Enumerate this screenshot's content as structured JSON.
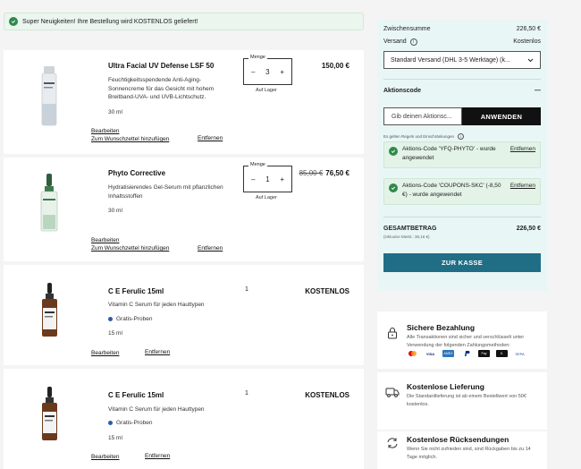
{
  "banner": {
    "text": "Super Neuigkeiten! Ihre Bestellung wird KOSTENLOS geliefert!"
  },
  "labels": {
    "quantity": "Menge",
    "in_stock": "Auf Lager",
    "edit": "Bearbeiten",
    "wishlist": "Zum Wunschzettel hinzufügen",
    "remove": "Entfernen",
    "minus": "–",
    "plus": "+"
  },
  "products": [
    {
      "name": "Ultra Facial UV Defense LSF 50",
      "description": "Feuchtigkeitsspendende Anti-Aging-Sonnencreme für das Gesicht mit hohem Breitband-UVA- und UVB-Lichtschutz.",
      "size": "30 ml",
      "quantity": "3",
      "price": "150,00 €"
    },
    {
      "name": "Phyto Corrective",
      "description": "Hydratisierendes Gel-Serum mit pflanzlichen Inhaltsstoffen",
      "size": "30 ml",
      "quantity": "1",
      "old_price": "85,00 €",
      "price": "76,50 €"
    },
    {
      "name": "C E Ferulic 15ml",
      "description": "Vitamin C Serum für jeden Hauttypen",
      "badge": "Gratis-Proben",
      "size": "15 ml",
      "quantity": "1",
      "price": "KOSTENLOS"
    },
    {
      "name": "C E Ferulic 15ml",
      "description": "Vitamin C Serum für jeden Hauttypen",
      "badge": "Gratis-Proben",
      "size": "15 ml",
      "quantity": "1",
      "price": "KOSTENLOS"
    }
  ],
  "summary": {
    "subtotal_label": "Zwischensumme",
    "subtotal_value": "226,50 €",
    "shipping_label": "Versand",
    "shipping_value": "Kostenlos",
    "shipping_select": "Standard Versand (DHL 3-5 Werktage) (k...",
    "coupon_label": "Aktionscode",
    "coupon_toggle": "—",
    "coupon_placeholder": "Gib deinen Aktionsc...",
    "apply_label": "ANWENDEN",
    "terms": "Es gelten Regeln und Einschränkungen",
    "applied": [
      {
        "text": "Aktions-Code 'YFQ-PHYTO' - wurde angewendet",
        "remove": "Entfernen"
      },
      {
        "text": "Aktions-Code 'COUPONS-SKC' (-8,50 €) - wurde angewendet",
        "remove": "Entfernen"
      }
    ],
    "total_label": "GESAMTBETRAG",
    "total_value": "226,50 €",
    "total_sub": "(inklusive MwSt.: 36,16 €)",
    "checkout_label": "ZUR KASSE"
  },
  "trust": [
    {
      "icon": "lock-icon",
      "title": "Sichere Bezahlung",
      "text": "Alle Transaktionen sind sicher und verschlüsselt unter Verwendung der folgenden Zahlungsmethoden:"
    },
    {
      "icon": "truck-icon",
      "title": "Kostenlose Lieferung",
      "text": "Die Standardlieferung ist ab einem Bestellwert von 50€ kostenlos."
    },
    {
      "icon": "return-icon",
      "title": "Kostenlose Rücksendungen",
      "text": "Wenn Sie nicht zufrieden sind, sind Rückgaben bis zu 14 Tage möglich."
    }
  ],
  "payment_methods": [
    "mastercard",
    "visa",
    "amex",
    "paypal",
    "apple-pay",
    "klarna",
    "sepa"
  ],
  "colors": {
    "accent": "#1f6e86",
    "summary_bg": "#e9f6f6",
    "success": "#2f8a4a"
  }
}
